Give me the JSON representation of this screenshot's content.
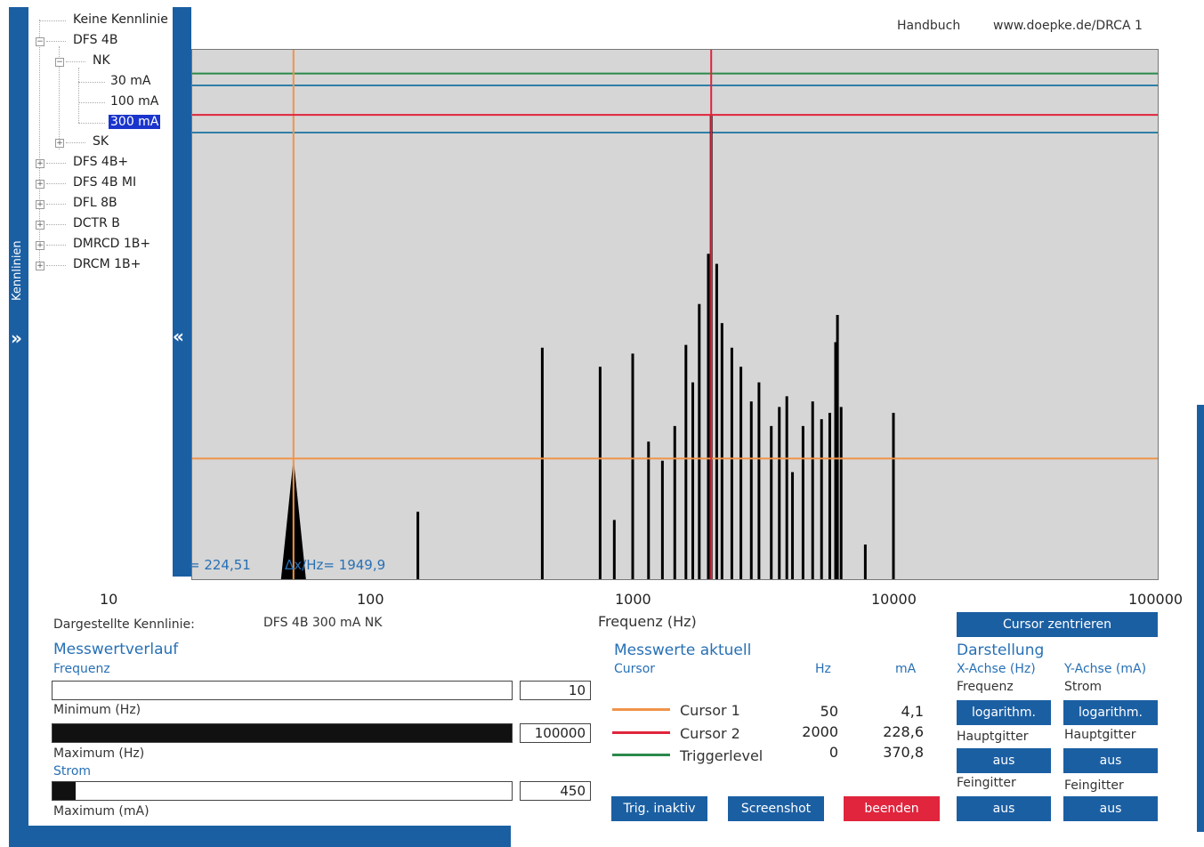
{
  "sidebar": {
    "title": "Kennlinien",
    "expand_icon": "chevron-right-double"
  },
  "tree": {
    "items": [
      {
        "label": "Keine Kennlinie",
        "state": "leaf"
      },
      {
        "label": "DFS 4B",
        "state": "expanded"
      },
      {
        "label": "NK",
        "state": "expanded"
      },
      {
        "label": "30 mA",
        "state": "leaf"
      },
      {
        "label": "100 mA",
        "state": "leaf"
      },
      {
        "label": "300 mA",
        "state": "selected"
      },
      {
        "label": "SK",
        "state": "collapsed"
      },
      {
        "label": "DFS 4B+",
        "state": "collapsed"
      },
      {
        "label": "DFS 4B MI",
        "state": "collapsed"
      },
      {
        "label": "DFL 8B",
        "state": "collapsed"
      },
      {
        "label": "DCTR B",
        "state": "collapsed"
      },
      {
        "label": "DMRCD 1B+",
        "state": "collapsed"
      },
      {
        "label": "DRCM 1B+",
        "state": "collapsed"
      }
    ]
  },
  "collapse_icon": "chevron-left-double",
  "links": {
    "manual": "Handbuch",
    "website": "www.doepke.de/DRCA 1"
  },
  "plot": {
    "readout_left": "= 224,51",
    "readout_right": "Δx/Hz= 1949,9",
    "x_ticks": [
      "10",
      "100",
      "1000",
      "10000",
      "100000"
    ],
    "xlabel": "Frequenz (Hz)"
  },
  "chart_data": {
    "type": "bar",
    "x_scale": "log",
    "xlim": [
      10,
      100000
    ],
    "xlabel": "Frequenz (Hz)",
    "peaks_hz_mA": [
      [
        50,
        4.1
      ],
      [
        150,
        2.2
      ],
      [
        350,
        0.4
      ],
      [
        450,
        15.0
      ],
      [
        750,
        12.0
      ],
      [
        850,
        2.0
      ],
      [
        1000,
        14.0
      ],
      [
        1150,
        5.0
      ],
      [
        1300,
        4.0
      ],
      [
        1450,
        6.0
      ],
      [
        1600,
        15.5
      ],
      [
        1700,
        10.0
      ],
      [
        1800,
        25.0
      ],
      [
        1950,
        45.0
      ],
      [
        2000,
        228.6
      ],
      [
        2100,
        40.0
      ],
      [
        2200,
        20.0
      ],
      [
        2400,
        15.0
      ],
      [
        2600,
        12.0
      ],
      [
        2850,
        8.0
      ],
      [
        3050,
        10.0
      ],
      [
        3400,
        6.0
      ],
      [
        3650,
        7.5
      ],
      [
        3900,
        8.5
      ],
      [
        4100,
        3.5
      ],
      [
        4500,
        6.0
      ],
      [
        4900,
        8.0
      ],
      [
        5300,
        6.5
      ],
      [
        5700,
        7.0
      ],
      [
        6000,
        16.0
      ],
      [
        6100,
        22.0
      ],
      [
        6300,
        7.5
      ],
      [
        7000,
        1.0
      ],
      [
        7800,
        1.5
      ],
      [
        8300,
        0.5
      ],
      [
        9000,
        0.4
      ],
      [
        10000,
        7.0
      ]
    ],
    "cursor1": {
      "hz": 50,
      "mA": 4.1,
      "color": "#f0944a"
    },
    "cursor2": {
      "hz": 2000,
      "mA": 228.6,
      "color": "#e0253d"
    },
    "triggerlevel": {
      "hz": 0,
      "mA": 370.8,
      "color": "#2a8a4a"
    },
    "ref_lines_color": "#2f7fa8"
  },
  "info": {
    "label": "Dargestellte Kennlinie:",
    "value": "DFS 4B 300 mA NK"
  },
  "history": {
    "title": "Messwertverlauf",
    "freq_title": "Frequenz",
    "freq_min_label": "Minimum (Hz)",
    "freq_min_value": "10",
    "freq_min_fraction": 0.0,
    "freq_max_label": "Maximum (Hz)",
    "freq_max_value": "100000",
    "freq_max_fraction": 1.0,
    "current_title": "Strom",
    "current_max_label": "Maximum (mA)",
    "current_max_value": "450",
    "current_max_fraction": 0.05
  },
  "measure": {
    "title": "Messwerte aktuell",
    "col_cursor": "Cursor",
    "col_hz": "Hz",
    "col_ma": "mA",
    "rows": [
      {
        "label": "Cursor 1",
        "hz": "50",
        "ma": "4,1",
        "color": "#f0944a"
      },
      {
        "label": "Cursor 2",
        "hz": "2000",
        "ma": "228,6",
        "color": "#e0253d"
      },
      {
        "label": "Triggerlevel",
        "hz": "0",
        "ma": "370,8",
        "color": "#2a8a4a"
      }
    ]
  },
  "buttons": {
    "trig": "Trig. inaktiv",
    "screenshot": "Screenshot",
    "quit": "beenden",
    "center": "Cursor zentrieren"
  },
  "display": {
    "title": "Darstellung",
    "x_axis": "X-Achse (Hz)",
    "y_axis": "Y-Achse (mA)",
    "x_sub": "Frequenz",
    "y_sub": "Strom",
    "x_scale": "logarithm.",
    "y_scale": "logarithm.",
    "main_grid_label": "Hauptgitter",
    "x_main_grid": "aus",
    "y_main_grid": "aus",
    "fine_grid_label": "Feingitter",
    "x_fine_grid": "aus",
    "y_fine_grid": "aus"
  }
}
